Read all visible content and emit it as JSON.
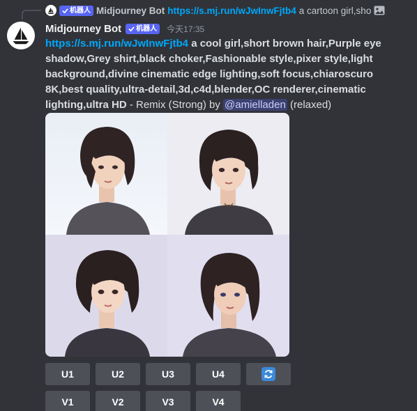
{
  "reply": {
    "badge": "机器人",
    "author": "Midjourney Bot",
    "link": "https://s.mj.run/wJwInwFjtb4",
    "snippet": "a cartoon girl,sho"
  },
  "message": {
    "author": "Midjourney Bot",
    "badge": "机器人",
    "timestamp": "今天17:35",
    "link": "https://s.mj.run/wJwInwFjtb4",
    "prompt": "a cool girl,short brown hair,Purple eye shadow,Grey shirt,black choker,Fashionable style,pixer style,light background,divine cinematic edge lighting,soft focus,chiaroscuro 8K,best quality,ultra-detail,3d,c4d,blender,OC renderer,cinematic lighting,ultra HD",
    "suffix": " - Remix (Strong) by ",
    "mention": "@amielladen",
    "mode": " (relaxed)"
  },
  "buttons": {
    "u1": "U1",
    "u2": "U2",
    "u3": "U3",
    "u4": "U4",
    "v1": "V1",
    "v2": "V2",
    "v3": "V3",
    "v4": "V4"
  },
  "colors": {
    "background": "#313338",
    "link": "#00a8fc",
    "badge": "#5865f2",
    "button": "#4e5058",
    "reroll": "#3b8ad9"
  },
  "icons": {
    "reply_avatar": "sailboat-icon",
    "avatar": "sailboat-icon",
    "image": "image-icon",
    "verified": "checkmark-icon",
    "reroll": "refresh-icon"
  }
}
